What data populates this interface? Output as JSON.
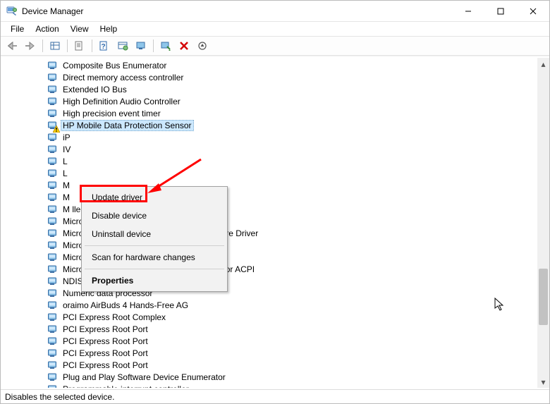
{
  "window": {
    "title": "Device Manager"
  },
  "menus": {
    "file": "File",
    "action": "Action",
    "view": "View",
    "help": "Help"
  },
  "toolbar_icons": [
    "back-arrow-icon",
    "forward-arrow-icon",
    "show-hidden-icon",
    "properties-sheet-icon",
    "help-icon",
    "update-driver-icon",
    "monitor-icon",
    "scan-hardware-icon",
    "uninstall-x-icon",
    "scan-down-icon"
  ],
  "devices": [
    {
      "label": "Composite Bus Enumerator",
      "warning": false,
      "selected": false
    },
    {
      "label": "Direct memory access controller",
      "warning": false,
      "selected": false
    },
    {
      "label": "Extended IO Bus",
      "warning": false,
      "selected": false
    },
    {
      "label": "High Definition Audio Controller",
      "warning": false,
      "selected": false
    },
    {
      "label": "High precision event timer",
      "warning": false,
      "selected": false
    },
    {
      "label": "HP Mobile Data Protection Sensor",
      "warning": true,
      "selected": true
    },
    {
      "label": "iP",
      "warning": false,
      "selected": false
    },
    {
      "label": "IV",
      "warning": false,
      "selected": false
    },
    {
      "label": "L",
      "warning": false,
      "selected": false
    },
    {
      "label": "L",
      "warning": false,
      "selected": false
    },
    {
      "label": "M",
      "warning": false,
      "selected": false
    },
    {
      "label": "M",
      "warning": false,
      "selected": false
    },
    {
      "label": "M                                                                                ller",
      "warning": false,
      "selected": false
    },
    {
      "label": "Microsoft ACPI-Compliant System",
      "warning": false,
      "selected": false
    },
    {
      "label": "Microsoft Hyper-V Virtualization Infrastructure Driver",
      "warning": false,
      "selected": false
    },
    {
      "label": "Microsoft System Management BIOS Driver",
      "warning": false,
      "selected": false
    },
    {
      "label": "Microsoft Virtual Drive Enumerator",
      "warning": false,
      "selected": false
    },
    {
      "label": "Microsoft Windows Management Interface for ACPI",
      "warning": false,
      "selected": false
    },
    {
      "label": "NDIS Virtual Network Adapter Enumerator",
      "warning": false,
      "selected": false
    },
    {
      "label": "Numeric data processor",
      "warning": false,
      "selected": false
    },
    {
      "label": "oraimo AirBuds 4 Hands-Free AG",
      "warning": false,
      "selected": false
    },
    {
      "label": "PCI Express Root Complex",
      "warning": false,
      "selected": false
    },
    {
      "label": "PCI Express Root Port",
      "warning": false,
      "selected": false
    },
    {
      "label": "PCI Express Root Port",
      "warning": false,
      "selected": false
    },
    {
      "label": "PCI Express Root Port",
      "warning": false,
      "selected": false
    },
    {
      "label": "PCI Express Root Port",
      "warning": false,
      "selected": false
    },
    {
      "label": "Plug and Play Software Device Enumerator",
      "warning": false,
      "selected": false
    },
    {
      "label": "Programmable interrupt controller",
      "warning": false,
      "selected": false
    }
  ],
  "context_menu": [
    {
      "label": "Update driver",
      "type": "item"
    },
    {
      "label": "Disable device",
      "type": "item"
    },
    {
      "label": "Uninstall device",
      "type": "item"
    },
    {
      "type": "sep"
    },
    {
      "label": "Scan for hardware changes",
      "type": "item"
    },
    {
      "type": "sep"
    },
    {
      "label": "Properties",
      "type": "item",
      "bold": true
    }
  ],
  "status": "Disables the selected device.",
  "colors": {
    "highlight_red": "#ff0000",
    "selection_blue": "#cce8ff"
  }
}
